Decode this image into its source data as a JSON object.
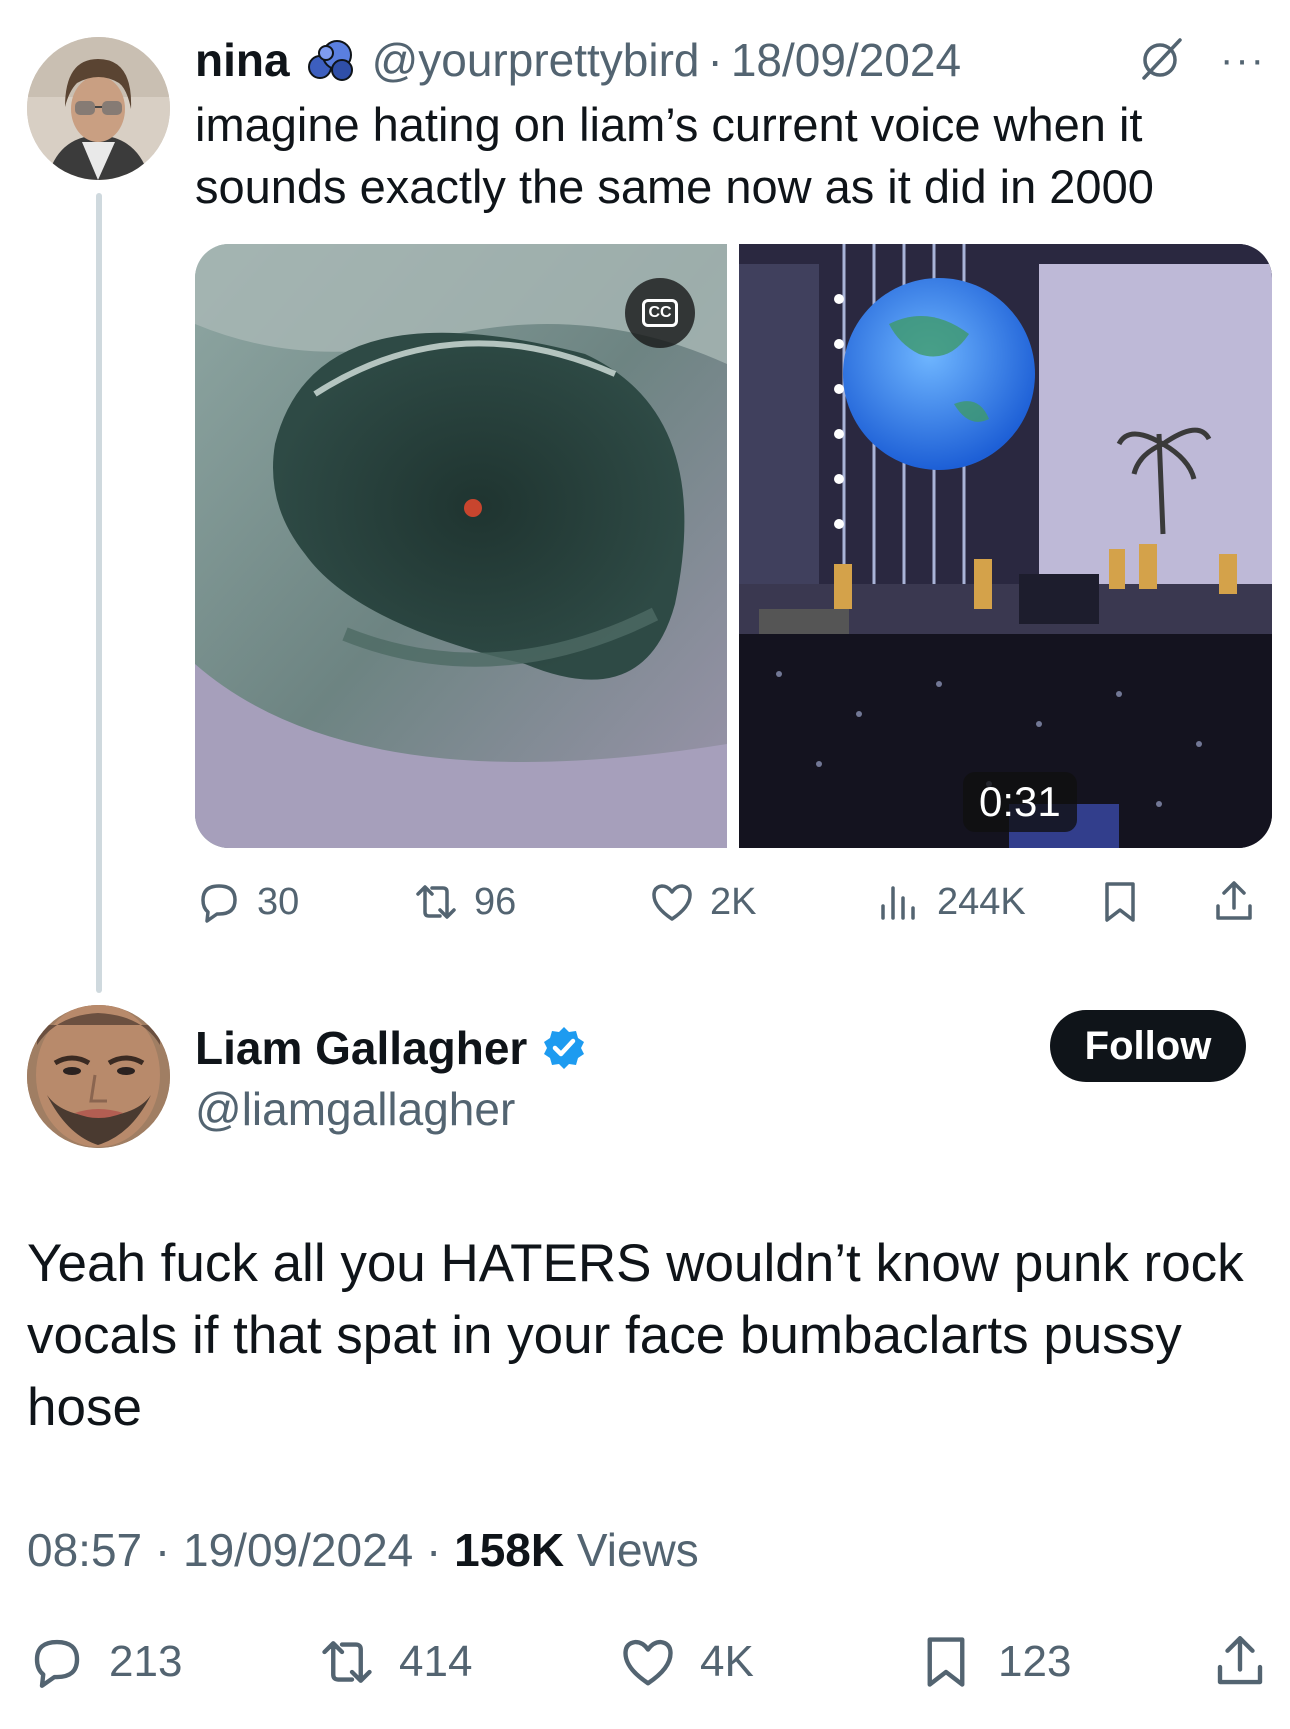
{
  "parent": {
    "name": "nina",
    "handle": "@yourprettybird",
    "separator": "·",
    "date": "18/09/2024",
    "more": "···",
    "text": "imagine hating on liam’s current voice when it sounds exactly the same now as it did in 2000",
    "media": {
      "cc_label": "CC",
      "duration": "0:31"
    },
    "stats": {
      "replies": "30",
      "reposts": "96",
      "likes": "2K",
      "views": "244K"
    }
  },
  "tweet": {
    "name": "Liam Gallagher",
    "handle": "@liamgallagher",
    "follow_label": "Follow",
    "text": "Yeah fuck all you HATERS wouldn’t know punk rock vocals if that spat in your face bumbaclarts pussy hose",
    "time": "08:57",
    "date": "19/09/2024",
    "views_count": "158K",
    "views_label": "Views",
    "stats": {
      "replies": "213",
      "reposts": "414",
      "likes": "4K",
      "bookmarks": "123"
    }
  },
  "colors": {
    "text": "#0f1419",
    "muted": "#536471",
    "verified": "#1d9bf0",
    "line": "#cfd9de"
  },
  "icons": [
    "blue-badge-icon",
    "grok-icon",
    "more-icon",
    "cc-icon",
    "reply-icon",
    "repost-icon",
    "like-icon",
    "views-icon",
    "bookmark-icon",
    "share-icon",
    "verified-icon"
  ]
}
